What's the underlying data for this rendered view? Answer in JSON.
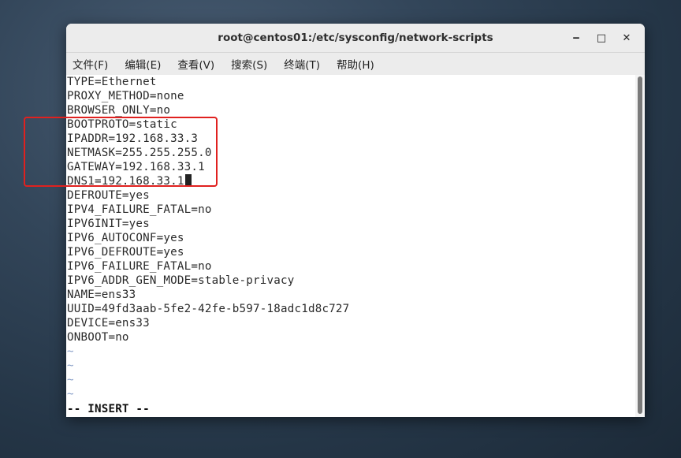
{
  "window": {
    "title": "root@centos01:/etc/sysconfig/network-scripts",
    "controls": {
      "minimize": "‒",
      "maximize": "□",
      "close": "✕"
    }
  },
  "menubar": {
    "items": [
      "文件(F)",
      "编辑(E)",
      "查看(V)",
      "搜索(S)",
      "终端(T)",
      "帮助(H)"
    ]
  },
  "terminal": {
    "lines": [
      "TYPE=Ethernet",
      "PROXY_METHOD=none",
      "BROWSER_ONLY=no",
      "BOOTPROTO=static",
      "IPADDR=192.168.33.3",
      "NETMASK=255.255.255.0",
      "GATEWAY=192.168.33.1",
      "DNS1=192.168.33.1",
      "DEFROUTE=yes",
      "IPV4_FAILURE_FATAL=no",
      "IPV6INIT=yes",
      "IPV6_AUTOCONF=yes",
      "IPV6_DEFROUTE=yes",
      "IPV6_FAILURE_FATAL=no",
      "IPV6_ADDR_GEN_MODE=stable-privacy",
      "NAME=ens33",
      "UUID=49fd3aab-5fe2-42fe-b597-18adc1d8c727",
      "DEVICE=ens33",
      "ONBOOT=no"
    ],
    "tildes": [
      "~",
      "~",
      "~",
      "~"
    ],
    "mode_status": "-- INSERT --"
  },
  "annotation": {
    "color": "#e0211f"
  }
}
